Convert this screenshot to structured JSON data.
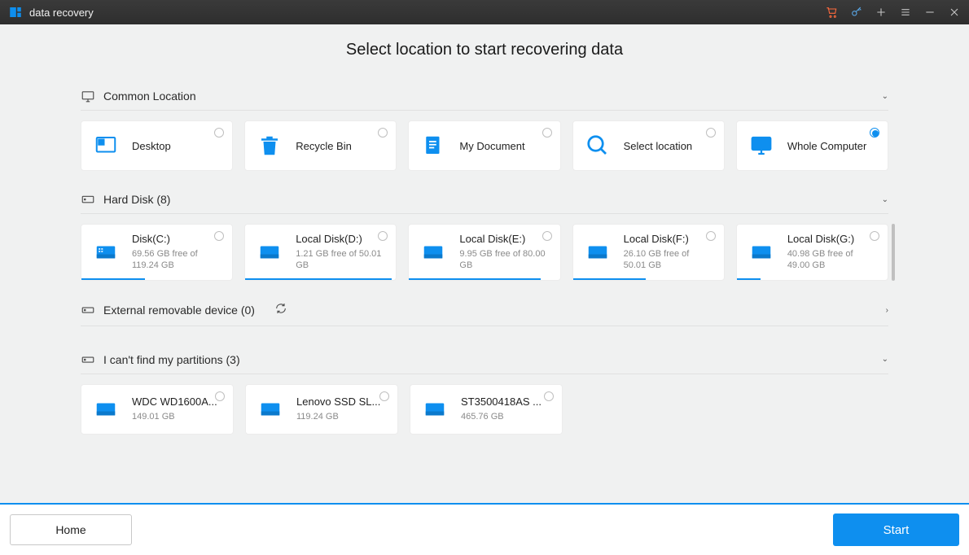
{
  "app": {
    "title": "data recovery"
  },
  "page": {
    "heading": "Select location to start recovering data"
  },
  "sections": {
    "common": {
      "label": "Common Location"
    },
    "hard_disk": {
      "label": "Hard Disk (8)"
    },
    "external": {
      "label": "External removable device (0)"
    },
    "lost": {
      "label": "I can't find my partitions (3)"
    }
  },
  "common_cards": [
    {
      "name": "Desktop"
    },
    {
      "name": "Recycle Bin"
    },
    {
      "name": "My Document"
    },
    {
      "name": "Select location"
    },
    {
      "name": "Whole Computer"
    }
  ],
  "disk_cards": [
    {
      "name": "Disk(C:)",
      "sub": "69.56 GB  free of 119.24 GB",
      "usage": 42
    },
    {
      "name": "Local Disk(D:)",
      "sub": "1.21 GB  free of 50.01 GB",
      "usage": 97
    },
    {
      "name": "Local Disk(E:)",
      "sub": "9.95 GB  free of 80.00 GB",
      "usage": 87
    },
    {
      "name": "Local Disk(F:)",
      "sub": "26.10 GB  free of 50.01 GB",
      "usage": 48
    },
    {
      "name": "Local Disk(G:)",
      "sub": "40.98 GB  free of 49.00 GB",
      "usage": 16
    }
  ],
  "lost_cards": [
    {
      "name": "WDC WD1600A...",
      "sub": "149.01 GB"
    },
    {
      "name": "Lenovo SSD SL...",
      "sub": "119.24 GB"
    },
    {
      "name": "ST3500418AS ...",
      "sub": "465.76 GB"
    }
  ],
  "footer": {
    "home": "Home",
    "start": "Start"
  }
}
